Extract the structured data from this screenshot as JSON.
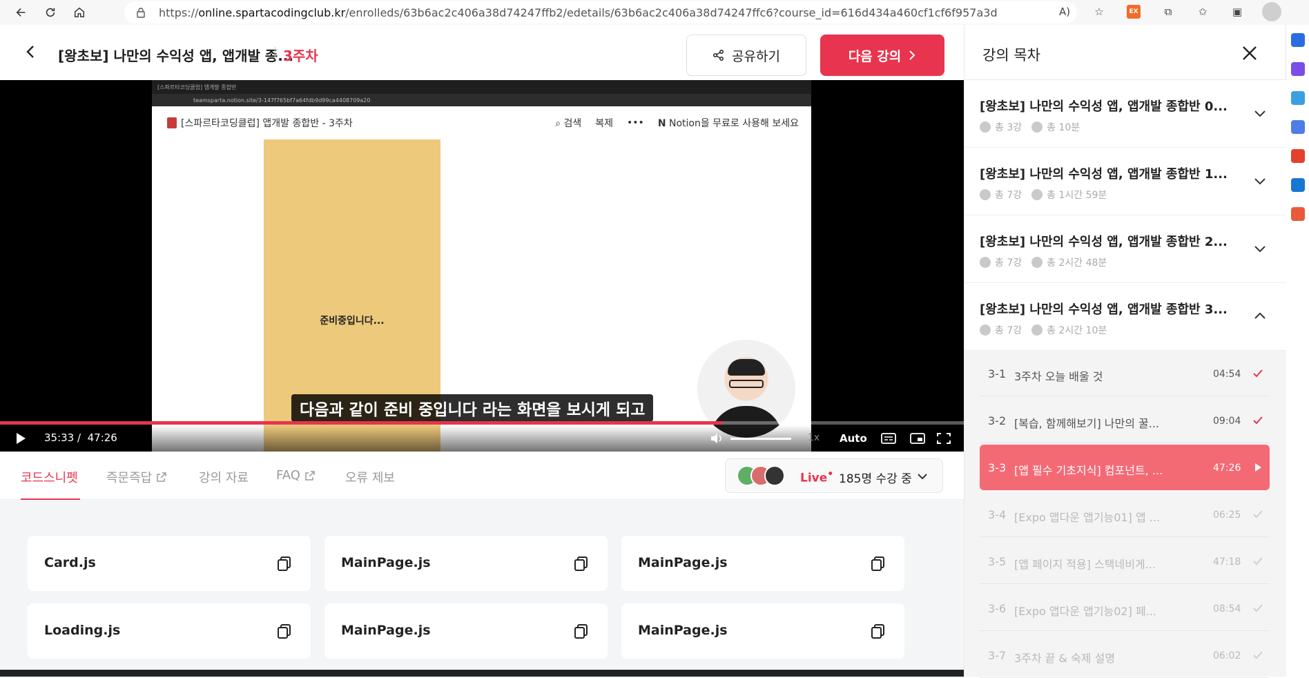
{
  "browser": {
    "url_prefix": "https://",
    "url_host": "online.spartacodingclub.kr",
    "url_path": "/enrolleds/63b6ac2c406a38d74247ffb2/edetails/63b6ac2c406a38d74247ffc6?course_id=616d434a460cf1cf6f957a3d",
    "ext_badge": "EX"
  },
  "header": {
    "course_title": "[왕초보] 나만의 수익성 앱, 앱개발 종...",
    "week": "3주차",
    "share_label": "공유하기",
    "next_label": "다음 강의"
  },
  "video": {
    "tab_title": "[스파르타코딩클럽] 앱개발 종합반",
    "inner_url": "teamsparta.notion.site/3-147f765bf7a64fdb9d99ca4408709a20",
    "notion_title": "[스파르타코딩클럽] 앱개발 종합반 - 3주차",
    "notion_search": "검색",
    "notion_duplicate": "복제",
    "notion_more": "•••",
    "notion_cta": "Notion을 무료로 사용해 보세요",
    "cover_text": "준비중입니다...",
    "caption": "다음과 같이 준비 중입니다 라는 화면을 보시게 되고",
    "current_time": "35:33 /",
    "total_time": "47:26",
    "progress": 0.749,
    "speed": "1x",
    "quality": "Auto"
  },
  "tabs": [
    {
      "label": "코드스니펫",
      "external": false
    },
    {
      "label": "즉문즉답",
      "external": true
    },
    {
      "label": "강의 자료",
      "external": false
    },
    {
      "label": "FAQ",
      "external": true
    },
    {
      "label": "오류 제보",
      "external": false
    }
  ],
  "live": {
    "label": "Live",
    "dot": "•",
    "count": "185명 수강 중"
  },
  "snippets": [
    {
      "name": "Card.js"
    },
    {
      "name": "MainPage.js"
    },
    {
      "name": "MainPage.js"
    },
    {
      "name": "Loading.js"
    },
    {
      "name": "MainPage.js"
    },
    {
      "name": "MainPage.js"
    }
  ],
  "panel": {
    "title": "강의 목차",
    "chapters": [
      {
        "title": "[왕초보] 나만의 수익성 앱, 앱개발 종합반 0...",
        "lessons": "총 3강",
        "duration": "총 10분",
        "expanded": false
      },
      {
        "title": "[왕초보] 나만의 수익성 앱, 앱개발 종합반 1...",
        "lessons": "총 7강",
        "duration": "총 1시간 59분",
        "expanded": false
      },
      {
        "title": "[왕초보] 나만의 수익성 앱, 앱개발 종합반 2...",
        "lessons": "총 7강",
        "duration": "총 2시간 48분",
        "expanded": false
      },
      {
        "title": "[왕초보] 나만의 수익성 앱, 앱개발 종합반 3...",
        "lessons": "총 7강",
        "duration": "총 2시간 10분",
        "expanded": true
      }
    ],
    "lessons": [
      {
        "num": "3-1",
        "title": "3주차 오늘 배울 것",
        "time": "04:54",
        "state": "done"
      },
      {
        "num": "3-2",
        "title": "[복습, 함께해보기] 나만의 꿀...",
        "time": "09:04",
        "state": "done"
      },
      {
        "num": "3-3",
        "title": "[앱 필수 기초지식] 컴포넌트, ...",
        "time": "47:26",
        "state": "current"
      },
      {
        "num": "3-4",
        "title": "[Expo 앱다운 앱기능01] 앱 ...",
        "time": "06:25",
        "state": "pending"
      },
      {
        "num": "3-5",
        "title": "[앱 페이지 적용] 스택네비게...",
        "time": "47:18",
        "state": "pending"
      },
      {
        "num": "3-6",
        "title": "[Expo 앱다운 앱기능02] 페...",
        "time": "08:54",
        "state": "pending"
      },
      {
        "num": "3-7",
        "title": "3주차 끝 & 숙제 설명",
        "time": "06:02",
        "state": "pending"
      }
    ]
  },
  "colors": {
    "accent": "#e8344e",
    "current_lesson": "#f36a75"
  }
}
